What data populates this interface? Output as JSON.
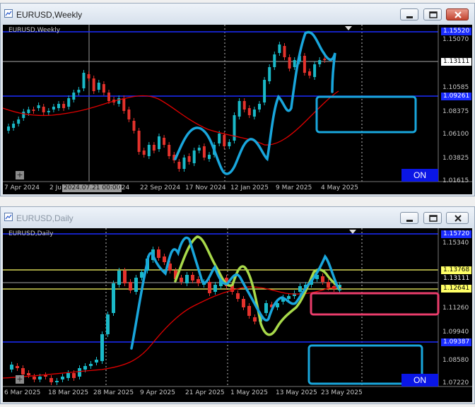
{
  "weekly": {
    "title": "EURUSD,Weekly",
    "symbol_label": "EURUSD,Weekly",
    "prices": [
      "1.15070",
      "1.13111",
      "1.10585",
      "1.08375",
      "1.06100",
      "1.03825",
      "1.01615"
    ],
    "price_boxes": {
      "top": "1.15520",
      "current": "1.13111",
      "blue": "1.09261"
    },
    "dates": [
      "7 Apr 2024",
      "2 Ju",
      "2024.07.21 00:00",
      "024",
      "22 Sep 2024",
      "17 Nov 2024",
      "12 Jan 2025",
      "9 Mar 2025",
      "4 May 2025"
    ],
    "on_label": "ON"
  },
  "daily": {
    "title": "EURUSD,Daily",
    "symbol_label": "EURUSD,Daily",
    "prices": [
      "1.15340",
      "1.13111",
      "1.11260",
      "1.09940",
      "1.08580",
      "1.07220"
    ],
    "price_boxes": {
      "top": "1.15720",
      "yellow_top": "1.13768",
      "current": "1.13111",
      "yellow_bottom": "1.12641",
      "blue": "1.09387"
    },
    "dates": [
      "6 Mar 2025",
      "18 Mar 2025",
      "28 Mar 2025",
      "9 Apr 2025",
      "21 Apr 2025",
      "1 May 2025",
      "13 May 2025",
      "23 May 2025"
    ],
    "on_label": "ON"
  },
  "colors": {
    "bull": "#1ab9c8",
    "bear": "#e4322c",
    "ma": "#e00000",
    "cyan": "#19a6dc",
    "lime": "#a8d94a",
    "pink": "#ea3d6b",
    "blue_line": "#1a2cff",
    "yellow": "#ffff66"
  }
}
